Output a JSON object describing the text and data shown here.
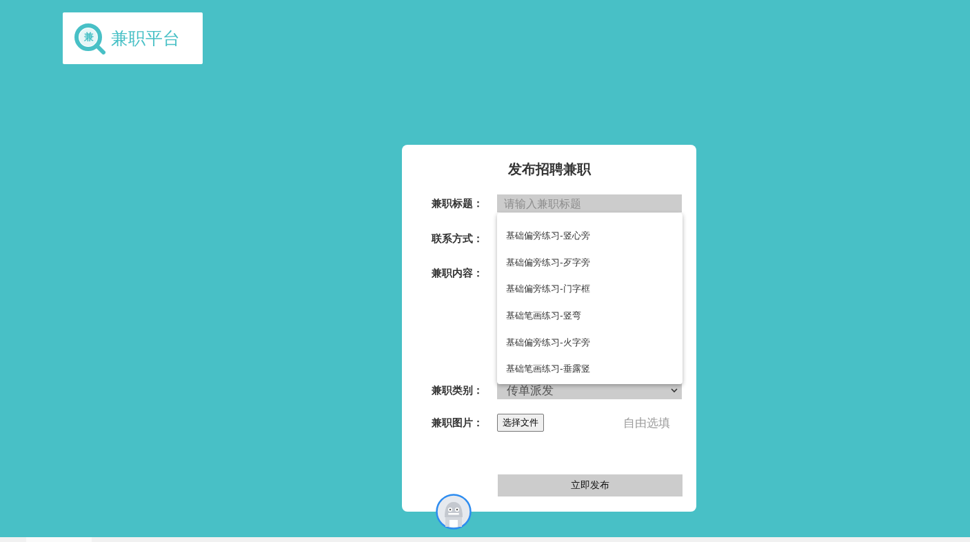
{
  "logo": {
    "glyph": "兼",
    "text": "兼职平台"
  },
  "form": {
    "title": "发布招聘兼职",
    "fields": [
      {
        "kind": "text",
        "label": "兼职标题：",
        "placeholder": "请输入兼职标题"
      },
      {
        "kind": "covered",
        "label": "联系方式："
      },
      {
        "kind": "covered-area",
        "label": "兼职内容："
      },
      {
        "kind": "select",
        "label": "兼职类别：",
        "value": "传单派发"
      },
      {
        "kind": "file",
        "label": "兼职图片：",
        "button": "选择文件",
        "hint": "自由选填"
      }
    ],
    "suggestions": [
      "基础偏旁练习-竖心旁",
      "基础偏旁练习-歹字旁",
      "基础偏旁练习-门字框",
      "基础笔画练习-竖弯",
      "基础偏旁练习-火字旁",
      "基础笔画练习-垂露竖"
    ],
    "submit": "立即发布"
  }
}
